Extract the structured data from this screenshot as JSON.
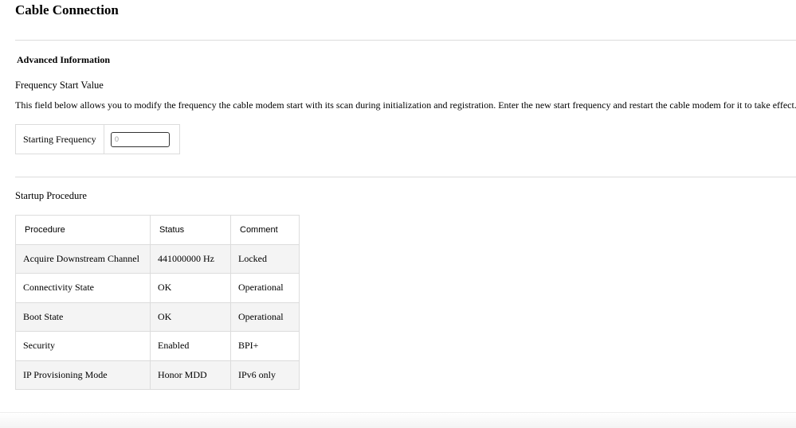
{
  "page": {
    "title": "Cable Connection"
  },
  "advanced": {
    "heading": "Advanced Information",
    "frequency_label": "Frequency Start Value",
    "description": "This field below allows you to modify the frequency the cable modem start with its scan during initialization and registration. Enter the new start frequency and restart the cable modem for it to take effect.",
    "starting_frequency_label": "Starting Frequency",
    "starting_frequency_placeholder": "0"
  },
  "startup": {
    "label": "Startup Procedure",
    "columns": [
      "Procedure",
      "Status",
      "Comment"
    ],
    "rows": [
      {
        "procedure": "Acquire Downstream Channel",
        "status": "441000000 Hz",
        "comment": "Locked"
      },
      {
        "procedure": "Connectivity State",
        "status": "OK",
        "comment": "Operational"
      },
      {
        "procedure": "Boot State",
        "status": "OK",
        "comment": "Operational"
      },
      {
        "procedure": "Security",
        "status": "Enabled",
        "comment": "BPI+"
      },
      {
        "procedure": "IP Provisioning Mode",
        "status": "Honor MDD",
        "comment": "IPv6 only"
      }
    ]
  }
}
